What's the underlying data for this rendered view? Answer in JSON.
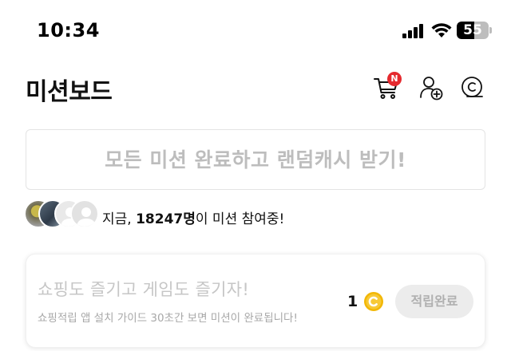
{
  "status_bar": {
    "time": "10:34",
    "battery_level": "55",
    "battery_fraction": 0.55
  },
  "header": {
    "title": "미션보드",
    "cart_badge": "N",
    "icons": [
      "cart-icon",
      "add-friend-icon",
      "cash-icon"
    ]
  },
  "banner": {
    "text": "모든 미션 완료하고 랜덤캐시 받기!"
  },
  "participants": {
    "prefix": "지금, ",
    "count": "18247명",
    "suffix": "이 미션 참여중!"
  },
  "mission": {
    "title": "쇼핑도 즐기고 게임도 즐기자!",
    "description": "쇼핑적립 앱 설치 가이드 30초간 보면 미션이 완료됩니다!",
    "reward": "1",
    "button_label": "적립완료"
  },
  "colors": {
    "badge": "#e5292e",
    "coin": "#f2b705",
    "banner_text": "#bdbdbd"
  }
}
